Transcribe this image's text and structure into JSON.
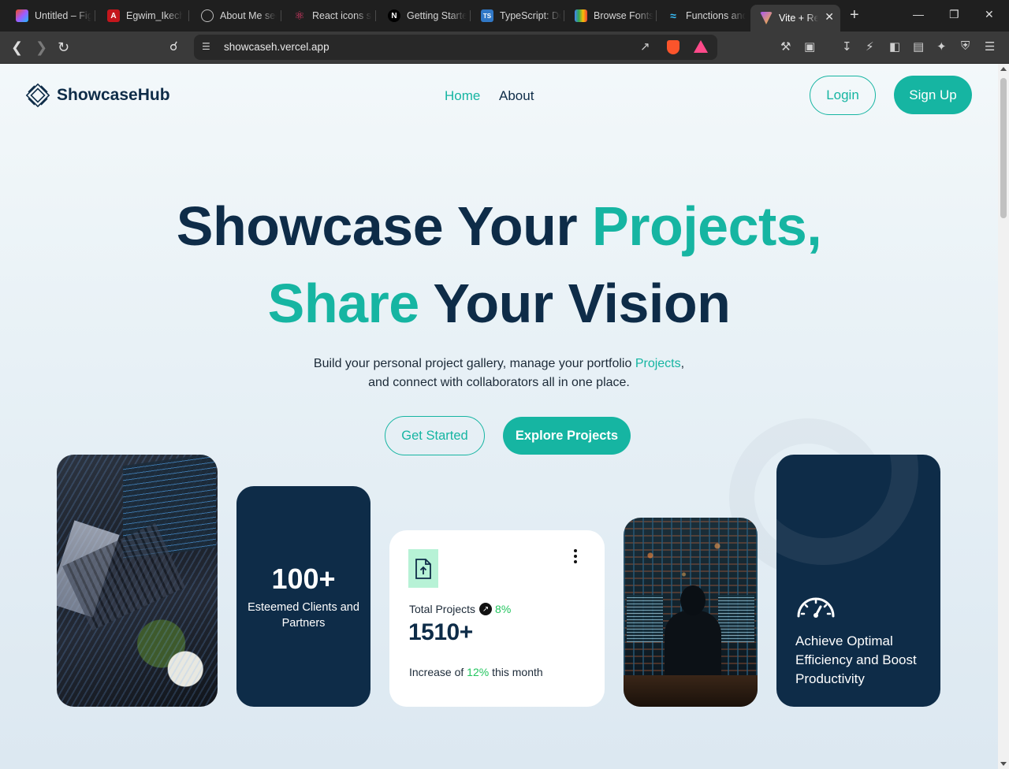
{
  "browser": {
    "tabs": [
      {
        "title": "Untitled – Figma",
        "icon": "figma-icon",
        "color": "#f24e1e"
      },
      {
        "title": "Egwim_Ikechukwu",
        "icon": "pdf-icon",
        "color": "#e02020"
      },
      {
        "title": "About Me section",
        "icon": "openai-icon",
        "color": "#bdbdbd"
      },
      {
        "title": "React icons search",
        "icon": "react-icon",
        "color": "#e23b6a"
      },
      {
        "title": "Getting Started",
        "icon": "nextjs-icon",
        "color": "#000000"
      },
      {
        "title": "TypeScript: Docs",
        "icon": "typescript-icon",
        "color": "#3178c6"
      },
      {
        "title": "Browse Fonts",
        "icon": "google-fonts-icon",
        "color": "#34a853"
      },
      {
        "title": "Functions and",
        "icon": "tailwind-icon",
        "color": "#38bdf8"
      },
      {
        "title": "Vite + React",
        "icon": "vite-icon",
        "color": "#a855f7",
        "active": true
      }
    ],
    "url": "showcaseh.vercel.app"
  },
  "header": {
    "brand": "ShowcaseHub",
    "nav": [
      "Home",
      "About"
    ],
    "login_label": "Login",
    "signup_label": "Sign Up"
  },
  "hero": {
    "line1_a": "Showcase Your ",
    "line1_b": "Projects,",
    "line2_a": "Share",
    "line2_b": " Your Vision",
    "sub1_a": "Build your personal project gallery, manage your portfolio ",
    "sub1_b": "Projects",
    "sub1_c": ",",
    "sub2": "and connect with collaborators all in one place.",
    "get_started": "Get Started",
    "explore": "Explore Projects"
  },
  "cards": {
    "clients_count": "100+",
    "clients_label": "Esteemed Clients and Partners",
    "projects_label": "Total Projects",
    "projects_pct": "8%",
    "projects_count": "1510+",
    "increase_prefix": "Increase of ",
    "increase_pct": "12%",
    "increase_suffix": " this month",
    "efficiency": "Achieve Optimal Efficiency and Boost Productivity"
  },
  "colors": {
    "accent": "#16b5a2",
    "navy": "#0e2c48",
    "positive": "#22c55e"
  }
}
